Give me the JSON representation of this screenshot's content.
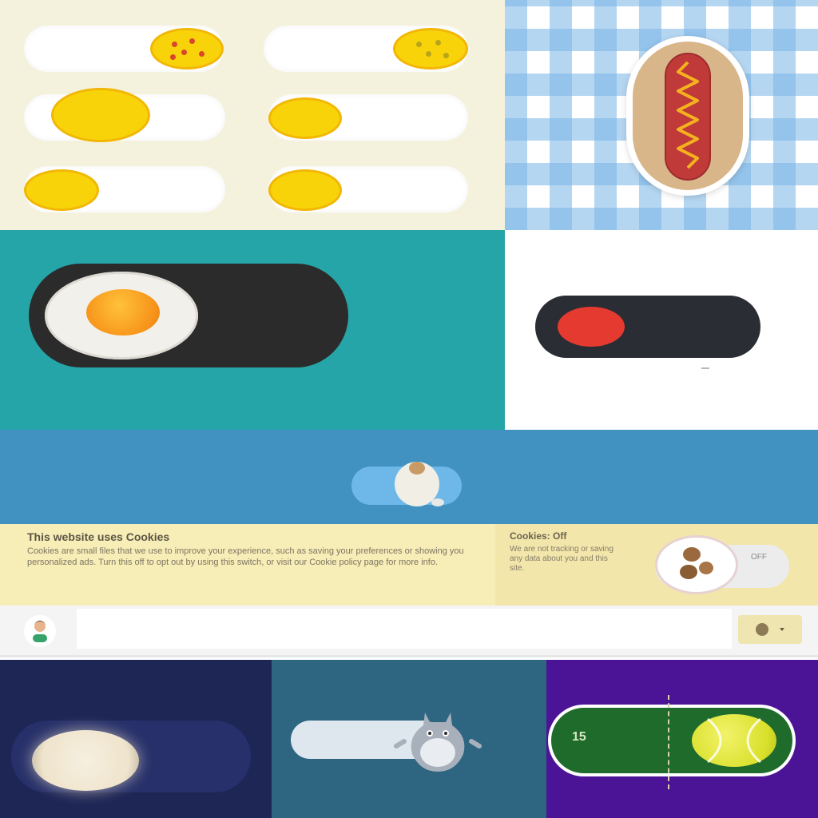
{
  "cookie_banner": {
    "title": "This website uses Cookies",
    "body": "Cookies are small files that we use to improve your experience, such as saving your preferences or showing you personalized ads. Turn this off to opt out by using this switch, or visit our Cookie policy page for more info.",
    "side_title": "Cookies: Off",
    "side_body": "We are not tracking or saving any data about you and this site.",
    "toggle_label": "OFF"
  },
  "tennis_toggle": {
    "court_label": "15"
  },
  "colors": {
    "cream": "#f4f2dc",
    "teal": "#26a5a8",
    "blue": "#4192c0",
    "yellow_banner": "#f7edb6",
    "navy": "#1e2656",
    "slate": "#2e6682",
    "purple": "#4b1395",
    "yolk": "#f8d30a",
    "red": "#e13a2a",
    "court_green": "#1f6b2c"
  },
  "icons": {
    "avatar": "user-avatar-icon",
    "toolbar_menu": "settings-dropdown-icon"
  }
}
